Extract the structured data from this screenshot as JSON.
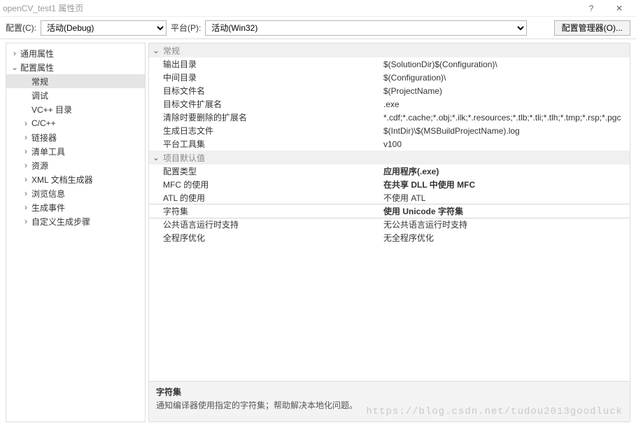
{
  "window": {
    "title": "openCV_test1 属性页",
    "help": "?",
    "close": "✕"
  },
  "toolbar": {
    "config_label": "配置(C):",
    "config_value": "活动(Debug)",
    "platform_label": "平台(P):",
    "platform_value": "活动(Win32)",
    "manager_button": "配置管理器(O)..."
  },
  "tree": [
    {
      "label": "通用属性",
      "depth": 0,
      "expander": ">"
    },
    {
      "label": "配置属性",
      "depth": 0,
      "expander": "v"
    },
    {
      "label": "常规",
      "depth": 1,
      "expander": "",
      "selected": true
    },
    {
      "label": "调试",
      "depth": 1,
      "expander": ""
    },
    {
      "label": "VC++ 目录",
      "depth": 1,
      "expander": ""
    },
    {
      "label": "C/C++",
      "depth": 1,
      "expander": ">"
    },
    {
      "label": "链接器",
      "depth": 1,
      "expander": ">"
    },
    {
      "label": "清单工具",
      "depth": 1,
      "expander": ">"
    },
    {
      "label": "资源",
      "depth": 1,
      "expander": ">"
    },
    {
      "label": "XML 文档生成器",
      "depth": 1,
      "expander": ">"
    },
    {
      "label": "浏览信息",
      "depth": 1,
      "expander": ">"
    },
    {
      "label": "生成事件",
      "depth": 1,
      "expander": ">"
    },
    {
      "label": "自定义生成步骤",
      "depth": 1,
      "expander": ">"
    }
  ],
  "propgrid": {
    "categories": [
      {
        "name": "常规",
        "rows": [
          {
            "key": "输出目录",
            "val": "$(SolutionDir)$(Configuration)\\"
          },
          {
            "key": "中间目录",
            "val": "$(Configuration)\\"
          },
          {
            "key": "目标文件名",
            "val": "$(ProjectName)"
          },
          {
            "key": "目标文件扩展名",
            "val": ".exe"
          },
          {
            "key": "清除时要删除的扩展名",
            "val": "*.cdf;*.cache;*.obj;*.ilk;*.resources;*.tlb;*.tli;*.tlh;*.tmp;*.rsp;*.pgc"
          },
          {
            "key": "生成日志文件",
            "val": "$(IntDir)\\$(MSBuildProjectName).log"
          },
          {
            "key": "平台工具集",
            "val": "v100"
          }
        ]
      },
      {
        "name": "项目默认值",
        "rows": [
          {
            "key": "配置类型",
            "val": "应用程序(.exe)",
            "bold": true
          },
          {
            "key": "MFC 的使用",
            "val": "在共享 DLL 中使用 MFC",
            "bold": true
          },
          {
            "key": "ATL 的使用",
            "val": "不使用 ATL"
          },
          {
            "key": "字符集",
            "val": "使用 Unicode 字符集",
            "bold": true,
            "selected": true
          },
          {
            "key": "公共语言运行时支持",
            "val": "无公共语言运行时支持"
          },
          {
            "key": "全程序优化",
            "val": "无全程序优化"
          }
        ]
      }
    ]
  },
  "help_panel": {
    "name": "字符集",
    "desc": "通知编译器使用指定的字符集；帮助解决本地化问题。"
  },
  "watermark": "https://blog.csdn.net/tudou2013goodluck"
}
